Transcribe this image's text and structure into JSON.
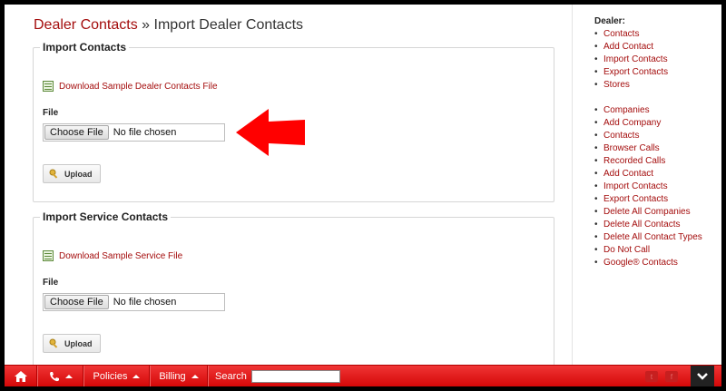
{
  "breadcrumb": {
    "parent": "Dealer Contacts",
    "separator": " » ",
    "current": "Import Dealer Contacts"
  },
  "import_contacts": {
    "legend": "Import Contacts",
    "download_link": "Download Sample Dealer Contacts File",
    "file_label": "File",
    "choose_button": "Choose File",
    "file_status": "No file chosen",
    "upload_button": "Upload"
  },
  "import_service": {
    "legend": "Import Service Contacts",
    "download_link": "Download Sample Service File",
    "file_label": "File",
    "choose_button": "Choose File",
    "file_status": "No file chosen",
    "upload_button": "Upload"
  },
  "annotation": {
    "icon": "red-arrow-left-icon",
    "color": "#ff0000"
  },
  "sidebar": {
    "title": "Dealer:",
    "group1": [
      "Contacts",
      "Add Contact",
      "Import Contacts",
      "Export Contacts",
      "Stores"
    ],
    "group2": [
      "Companies",
      "Add Company",
      "Contacts",
      "Browser Calls",
      "Recorded Calls",
      "Add Contact",
      "Import Contacts",
      "Export Contacts",
      "Delete All Companies",
      "Delete All Contacts",
      "Delete All Contact Types",
      "Do Not Call",
      "Google® Contacts"
    ]
  },
  "footer": {
    "policies": "Policies",
    "billing": "Billing",
    "search_label": "Search",
    "search_value": "",
    "icons": [
      "home-icon",
      "phone-icon",
      "twitter-icon",
      "facebook-icon",
      "chevron-down-icon"
    ]
  },
  "colors": {
    "link": "#a40d0d",
    "footer_bar": "#e01f1f",
    "arrow": "#ff0000"
  }
}
